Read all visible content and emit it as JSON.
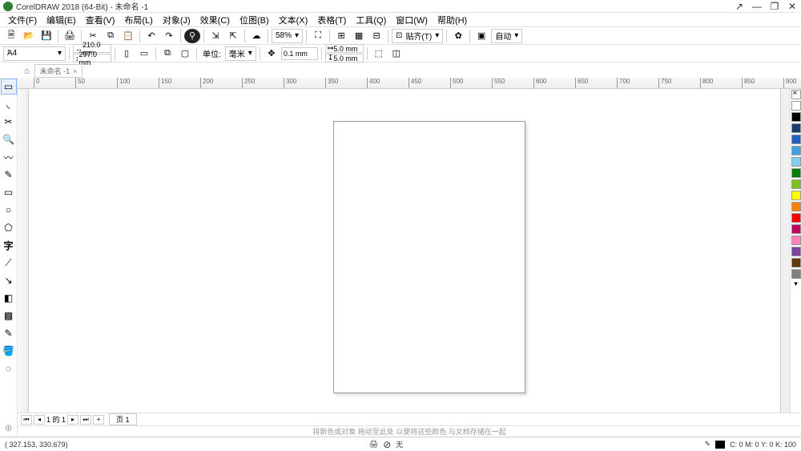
{
  "title": "CorelDRAW 2018 (64-Bit) - 未命名 -1",
  "menu": [
    "文件(F)",
    "编辑(E)",
    "查看(V)",
    "布局(L)",
    "对象(J)",
    "效果(C)",
    "位图(B)",
    "文本(X)",
    "表格(T)",
    "工具(Q)",
    "窗口(W)",
    "帮助(H)"
  ],
  "zoom": "58%",
  "autolabel": "自动",
  "paper": {
    "size": "A4",
    "w": "210.0 mm",
    "h": "297.0 mm"
  },
  "unitlabel": "单位:",
  "unit": "毫米",
  "nudge": "0.1 mm",
  "dup": {
    "x": "5.0 mm",
    "y": "5.0 mm"
  },
  "snaplabel": "贴齐(T)",
  "doc_tab": "未命名 -1",
  "ruler_ticks": [
    "0",
    "50",
    "100",
    "150",
    "200",
    "250",
    "300",
    "350",
    "400",
    "450",
    "500",
    "550",
    "600",
    "650",
    "700",
    "750",
    "800",
    "850",
    "900"
  ],
  "pagebar": {
    "nav": "1",
    "of": "的 1",
    "pagelabel": "页 1"
  },
  "hint": "将新色或对象 拖动至此处   以便将这些颜色 与文档存储在一起",
  "status": {
    "coords": "( 327.153, 330.679)",
    "fill": "无",
    "cmyk": "C: 0 M: 0 Y: 0 K: 100"
  },
  "palette": [
    "#ffffff",
    "#000000",
    "#1a3a6e",
    "#2060c0",
    "#40a0e0",
    "#80d0f0",
    "#008000",
    "#80c020",
    "#ffff00",
    "#ff8000",
    "#ff0000",
    "#c00060",
    "#ff80c0",
    "#8040a0",
    "#603810",
    "#808080"
  ]
}
